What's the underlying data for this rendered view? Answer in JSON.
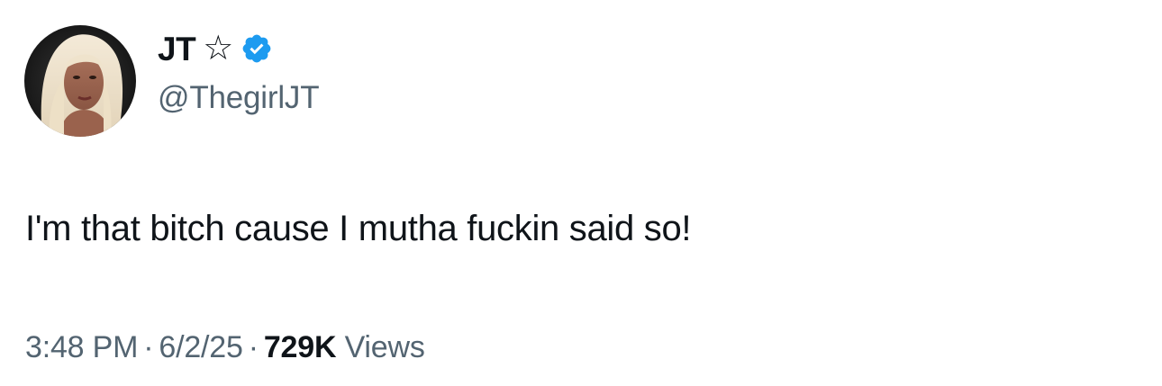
{
  "tweet": {
    "author": {
      "display_name": "JT",
      "handle": "@ThegirlJT",
      "badge_icon": "star-outline-icon",
      "verified_icon": "verified-badge-icon",
      "verified_color": "#1d9bf0"
    },
    "text": "I'm that bitch cause I mutha fuckin said so!",
    "meta": {
      "time": "3:48 PM",
      "separator": "·",
      "date": "6/2/25",
      "views_count": "729K",
      "views_label": "Views"
    }
  },
  "colors": {
    "primary_text": "#0f1419",
    "secondary_text": "#536471",
    "background": "#ffffff"
  }
}
